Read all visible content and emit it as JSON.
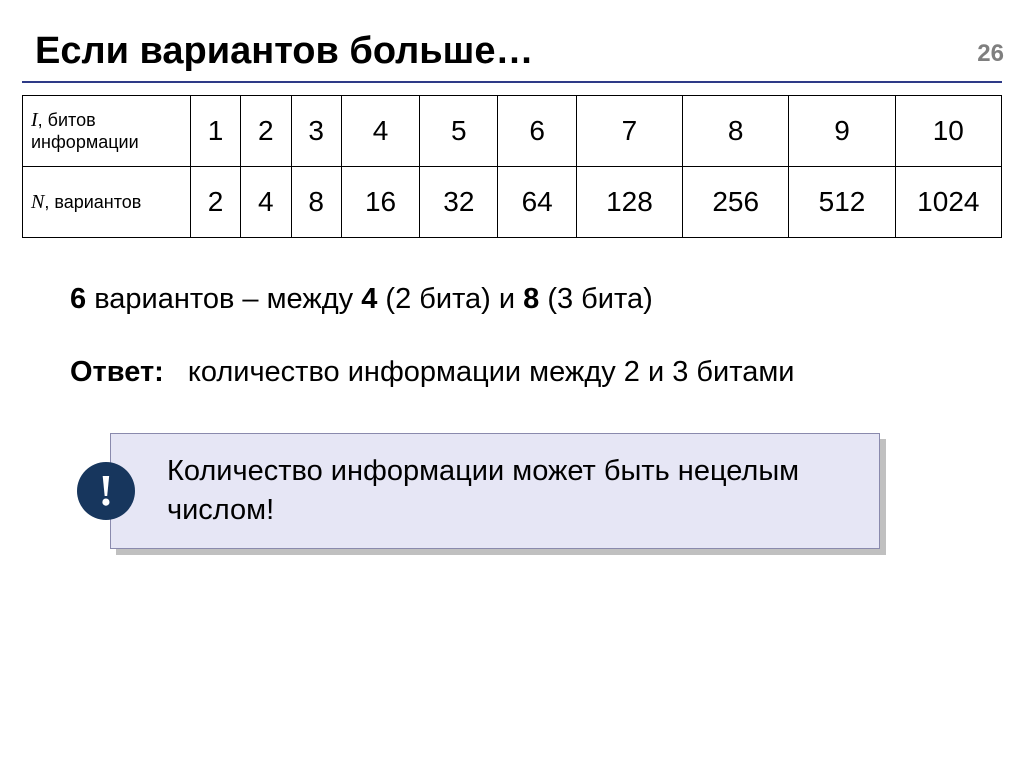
{
  "page_number": "26",
  "title": "Если вариантов больше…",
  "table": {
    "row1": {
      "header_sym": "I",
      "header_rest": ", битов информации",
      "cells": [
        "1",
        "2",
        "3",
        "4",
        "5",
        "6",
        "7",
        "8",
        "9",
        "10"
      ]
    },
    "row2": {
      "header_sym": "N",
      "header_rest": ", вариантов",
      "cells": [
        "2",
        "4",
        "8",
        "16",
        "32",
        "64",
        "128",
        "256",
        "512",
        "1024"
      ]
    }
  },
  "line": {
    "b1": "6",
    "t1": " вариантов – между ",
    "b2": "4",
    "t2": " (2 бита) и ",
    "b3": "8",
    "t3": " (3 бита)"
  },
  "answer": {
    "label": "Ответ:",
    "text": "количество информации между 2 и 3 битами"
  },
  "callout": {
    "bang": "!",
    "text": "Количество информации может быть нецелым числом!"
  }
}
